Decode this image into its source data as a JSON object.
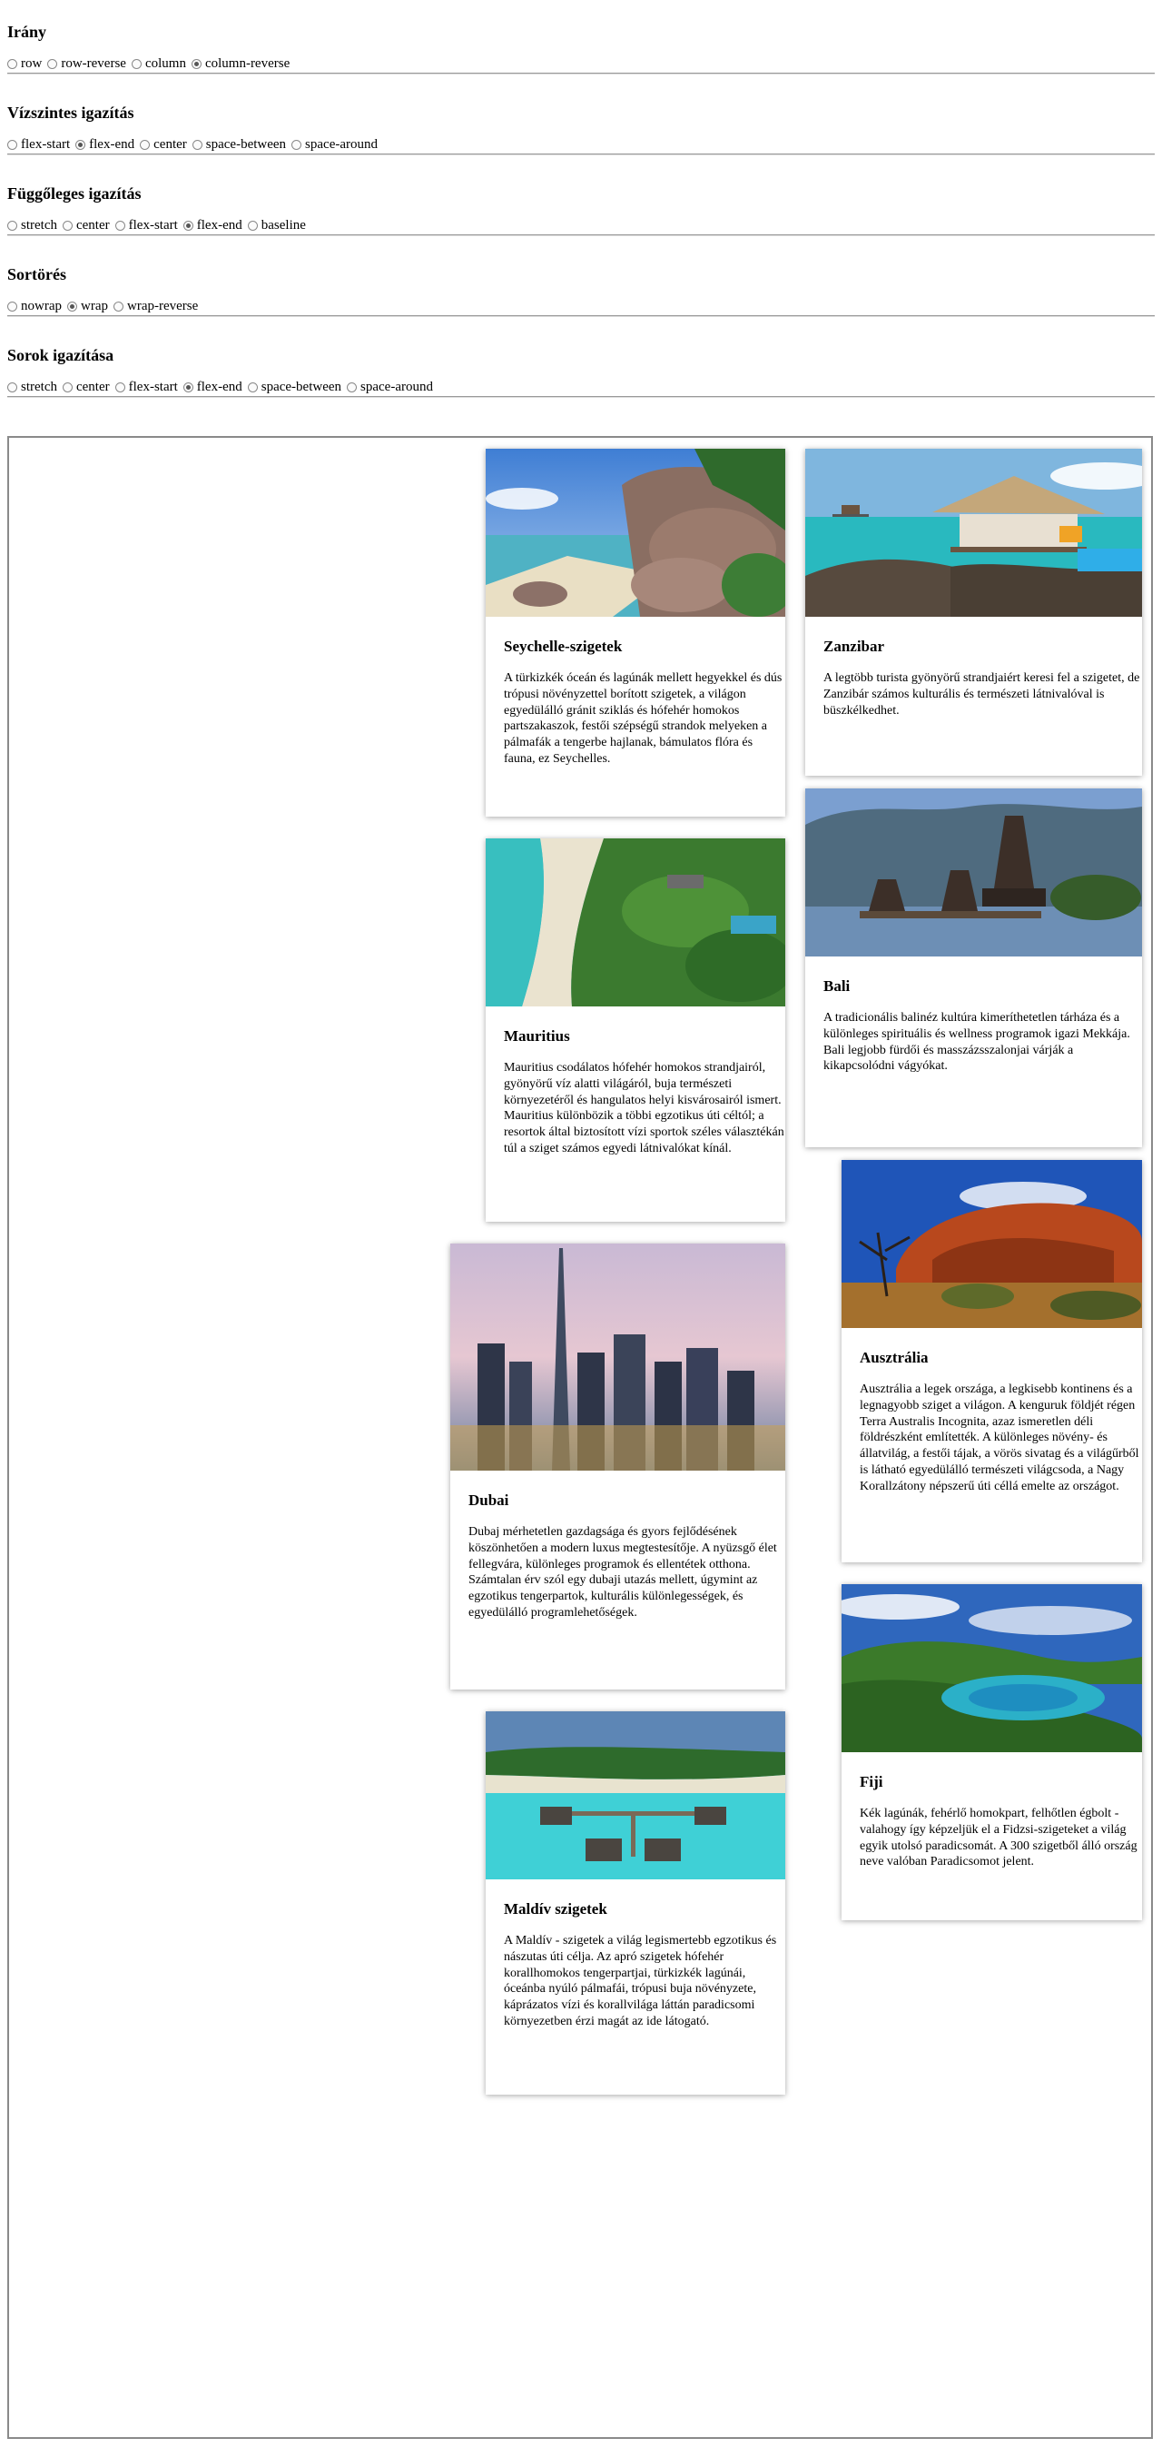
{
  "controls": {
    "direction": {
      "title": "Irány",
      "options": [
        "row",
        "row-reverse",
        "column",
        "column-reverse"
      ],
      "selected": "column-reverse"
    },
    "justify": {
      "title": "Vízszintes igazítás",
      "options": [
        "flex-start",
        "flex-end",
        "center",
        "space-between",
        "space-around"
      ],
      "selected": "flex-end"
    },
    "align_items": {
      "title": "Függőleges igazítás",
      "options": [
        "stretch",
        "center",
        "flex-start",
        "flex-end",
        "baseline"
      ],
      "selected": "flex-end"
    },
    "wrap": {
      "title": "Sortörés",
      "options": [
        "nowrap",
        "wrap",
        "wrap-reverse"
      ],
      "selected": "wrap"
    },
    "align_content": {
      "title": "Sorok igazítása",
      "options": [
        "stretch",
        "center",
        "flex-start",
        "flex-end",
        "space-between",
        "space-around"
      ],
      "selected": "flex-end"
    }
  },
  "cards": [
    {
      "title": "Seychelle-szigetek",
      "text": "A türkizkék óceán és lagúnák mellett hegyekkel és dús trópusi növényzettel borított szigetek, a világon egyedülálló gránit sziklás és hófehér homokos partszakaszok, festői szépségű strandok melyeken a pálmafák a tengerbe hajlanak, bámulatos flóra és fauna, ez Seychelles.",
      "image": "beach-granite-rocks"
    },
    {
      "title": "Zanzibar",
      "text": "A legtöbb turista gyönyörű strandjaiért keresi fel a szigetet, de Zanzibár számos kulturális és természeti látnivalóval is büszkélkedhet.",
      "image": "beach-hut-pier"
    },
    {
      "title": "Mauritius",
      "text": "Mauritius csodálatos hófehér homokos strandjairól, gyönyörű víz alatti világáról, buja természeti környezetéről és hangulatos helyi kisvárosairól ismert. Mauritius különbözik a többi egzotikus úti céltól; a resortok által biztosított vízi sportok széles választékán túl a sziget számos egyedi látnivalókat kínál.",
      "image": "beach-palms"
    },
    {
      "title": "Bali",
      "text": "A tradicionális balinéz kultúra kimeríthetetlen tárháza és a különleges spirituális és wellness programok igazi Mekkája. Bali legjobb fürdői és masszázsszalonjai várják a kikapcsolódni vágyókat.",
      "image": "temple-lake"
    },
    {
      "title": "Dubai",
      "text": "Dubaj mérhetetlen gazdagsága és gyors fejlődésének köszönhetően a modern luxus megtestesítője. A nyüzsgő élet fellegvára, különleges programok és ellentétek otthona. Számtalan érv szól egy dubaji utazás mellett, úgymint az egzotikus tengerpartok, kulturális különlegességek, és egyedülálló programlehetőségek.",
      "image": "city-skyline"
    },
    {
      "title": "Ausztrália",
      "text": "Ausztrália a legek országa, a legkisebb kontinens és a legnagyobb sziget a világon. A kenguruk földjét régen Terra Australis Incognita, azaz ismeretlen déli földrészként említették. A különleges növény- és állatvilág, a festői tájak, a vörös sivatag és a világűrből is látható egyedülálló természeti világcsoda, a Nagy Korallzátony népszerű úti céllá emelte az országot.",
      "image": "red-rock-outback"
    },
    {
      "title": "Maldív szigetek",
      "text": "A Maldív - szigetek a világ legismertebb egzotikus és nászutas úti célja. Az apró szigetek hófehér korallhomokos tengerpartjai, türkizkék lagúnái, óceánba nyúló pálmafái, trópusi buja növényzete, káprázatos vízi és korallvilága láttán paradicsomi környezetben érzi magát az ide látogató.",
      "image": "overwater-villas"
    },
    {
      "title": "Fiji",
      "text": "Kék lagúnák, fehérlő homokpart, felhőtlen égbolt - valahogy így képzeljük el a Fidzsi-szigeteket a világ egyik utolsó paradicsomát. A 300 szigetből álló ország neve valóban Paradicsomot jelent.",
      "image": "green-island-bay"
    }
  ]
}
